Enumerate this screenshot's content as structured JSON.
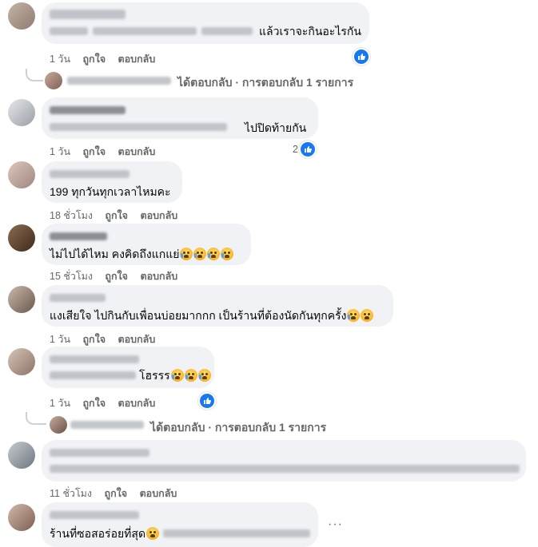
{
  "comments": [
    {
      "text_tail": "แล้วเราจะกินอะไรกัน",
      "time": "1 วัน",
      "like": "ถูกใจ",
      "reply": "ตอบกลับ",
      "reaction_count": ""
    },
    {
      "text_tail": "ไปปิดท้ายกัน",
      "time": "1 วัน",
      "like": "ถูกใจ",
      "reply": "ตอบกลับ",
      "reaction_count": "2"
    },
    {
      "text": "199 ทุกวันทุกเวลาไหมคะ",
      "time": "18 ชั่วโมง",
      "like": "ถูกใจ",
      "reply": "ตอบกลับ"
    },
    {
      "text": "ไม่ไปได้ไหม คงคิดถึงแกแย่",
      "time": "15 ชั่วโมง",
      "like": "ถูกใจ",
      "reply": "ตอบกลับ"
    },
    {
      "text": "แงเสียใจ ไปกินกับเพื่อนบ่อยมากกก เป็นร้านที่ต้องนัดกันทุกครั้ง",
      "time": "1 วัน",
      "like": "ถูกใจ",
      "reply": "ตอบกลับ"
    },
    {
      "text_tail": "โฮรรร",
      "time": "1 วัน",
      "like": "ถูกใจ",
      "reply": "ตอบกลับ"
    },
    {
      "time": "11 ชั่วโมง",
      "like": "ถูกใจ",
      "reply": "ตอบกลับ"
    },
    {
      "text": "ร้านที่ซอสอร่อยที่สุด"
    }
  ],
  "replies": [
    {
      "label": "ได้ตอบกลับ · การตอบกลับ 1 รายการ"
    },
    {
      "label": "ได้ตอบกลับ · การตอบกลับ 1 รายการ"
    }
  ],
  "more_label": "···",
  "icons": {
    "like": "thumbs-up-icon",
    "emoji": "crying-face-icon"
  },
  "colors": {
    "like_blue": "#1877f2",
    "bubble": "#f0f2f5",
    "meta": "#65676b"
  }
}
